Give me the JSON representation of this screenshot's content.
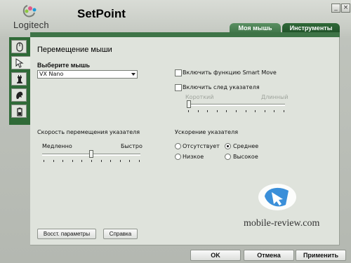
{
  "header": {
    "logo_text": "Logitech",
    "app_title": "SetPoint",
    "minimize_label": "_",
    "close_label": "×"
  },
  "tabs": [
    {
      "label": "Моя мышь",
      "active": true
    },
    {
      "label": "Инструменты",
      "active": false
    }
  ],
  "sidebar": {
    "items": [
      {
        "icon": "mouse-icon",
        "active": false
      },
      {
        "icon": "cursor-icon",
        "active": true
      },
      {
        "icon": "chess-icon",
        "active": false
      },
      {
        "icon": "game-icon",
        "active": false
      },
      {
        "icon": "battery-icon",
        "active": false
      }
    ]
  },
  "section": {
    "title": "Перемещение мыши",
    "select_mouse_label": "Выберите мышь",
    "selected_mouse": "VX Nano"
  },
  "options": {
    "smart_move": {
      "label": "Включить функцию Smart Move",
      "checked": false
    },
    "pointer_trail": {
      "label": "Включить след указателя",
      "checked": false
    },
    "trail_min_label": "Короткий",
    "trail_max_label": "Длинный",
    "trail_level": 0.0
  },
  "speed": {
    "title": "Скорость перемещения указателя",
    "min_label": "Медленно",
    "max_label": "Быстро",
    "level": 0.5
  },
  "acceleration": {
    "title": "Ускорение указателя",
    "options": [
      {
        "label": "Отсутствует",
        "checked": false
      },
      {
        "label": "Среднее",
        "checked": true
      },
      {
        "label": "Низкое",
        "checked": false
      },
      {
        "label": "Высокое",
        "checked": false
      }
    ]
  },
  "panel_buttons": {
    "restore": "Восст. параметры",
    "help": "Справка"
  },
  "footer_buttons": {
    "ok": "OK",
    "cancel": "Отмена",
    "apply": "Применить"
  },
  "watermark": "mobile-review.com",
  "colors": {
    "accent_green": "#3e7447",
    "dark_green": "#1f5128",
    "panel_bg": "#dfe3dc"
  }
}
